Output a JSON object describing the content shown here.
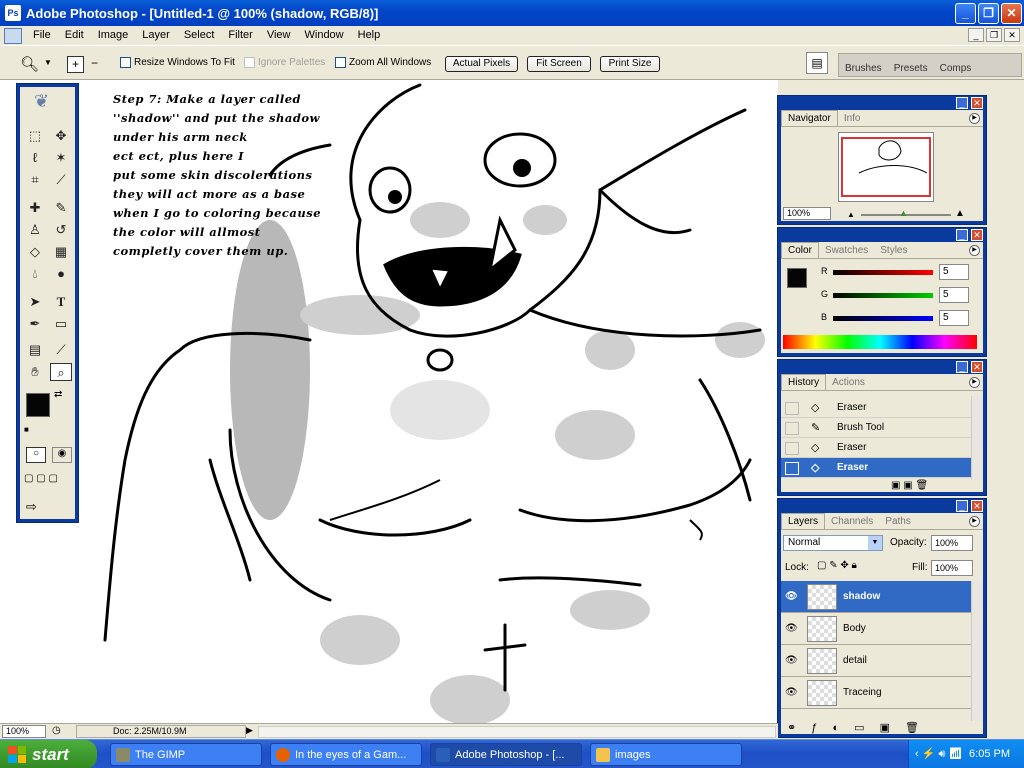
{
  "window": {
    "title": "Adobe Photoshop - [Untitled-1 @ 100% (shadow, RGB/8)]"
  },
  "menu": [
    "File",
    "Edit",
    "Image",
    "Layer",
    "Select",
    "Filter",
    "View",
    "Window",
    "Help"
  ],
  "options": {
    "resize_windows": "Resize Windows To Fit",
    "ignore_palettes": "Ignore Palettes",
    "zoom_all": "Zoom All Windows",
    "actual_pixels": "Actual Pixels",
    "fit_screen": "Fit Screen",
    "print_size": "Print Size"
  },
  "palette_well": [
    "Brushes",
    "Presets",
    "Comps"
  ],
  "canvas_note": {
    "lines": [
      "Step 7: Make a layer called",
      "''shadow'' and put the shadow",
      "under his arm neck",
      "ect ect, plus here I",
      "put some skin discolerations",
      "they will act more as a base",
      "when I go to coloring because",
      "the color will allmost",
      "completly cover them up."
    ]
  },
  "navigator": {
    "tabs": [
      "Navigator",
      "Info"
    ],
    "zoom": "100%"
  },
  "color_panel": {
    "tabs": [
      "Color",
      "Swatches",
      "Styles"
    ],
    "r_label": "R",
    "r": "5",
    "g_label": "G",
    "g": "5",
    "b_label": "B",
    "b": "5"
  },
  "history": {
    "tabs": [
      "History",
      "Actions"
    ],
    "items": [
      "Eraser",
      "Brush Tool",
      "Eraser",
      "Eraser"
    ]
  },
  "layers": {
    "tabs": [
      "Layers",
      "Channels",
      "Paths"
    ],
    "blend_mode": "Normal",
    "opacity_label": "Opacity:",
    "opacity": "100%",
    "lock_label": "Lock:",
    "fill_label": "Fill:",
    "fill": "100%",
    "items": [
      "shadow",
      "Body",
      "detail",
      "Traceing"
    ]
  },
  "status": {
    "zoom": "100%",
    "doc": "Doc: 2.25M/10.9M"
  },
  "taskbar": {
    "start": "start",
    "items": [
      "The GIMP",
      "In the eyes of a Gam...",
      "Adobe Photoshop - [...",
      "images"
    ],
    "clock": "6:05 PM"
  },
  "colors": {
    "xp_blue": "#0a3a9e",
    "selection": "#316ac5",
    "start_green": "#318a22"
  }
}
